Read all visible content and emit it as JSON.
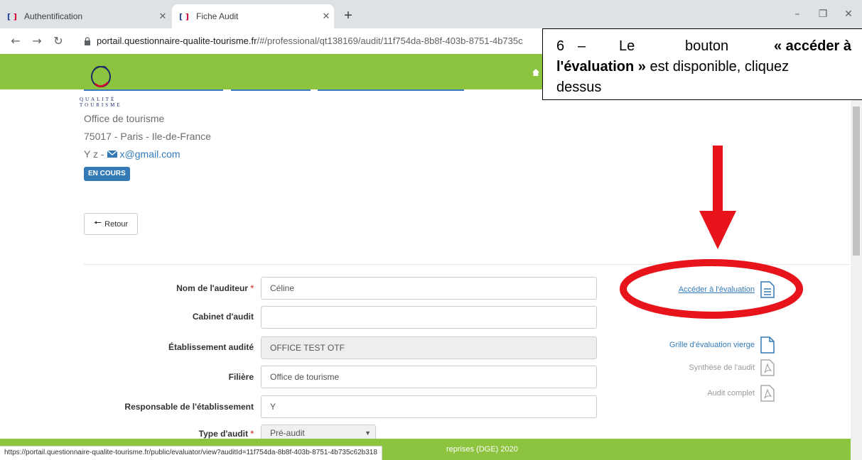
{
  "browser": {
    "tabs": [
      {
        "title": "Authentification",
        "active": false
      },
      {
        "title": "Fiche Audit",
        "active": true
      }
    ],
    "url_host": "portail.questionnaire-qualite-tourisme.fr",
    "url_path": "/#/professional/qt138169/audit/11f754da-8b8f-403b-8751-4b735c",
    "status_url": "https://portail.questionnaire-qualite-tourisme.fr/public/evaluator/view?auditId=11f754da-8b8f-403b-8751-4b735c62b318"
  },
  "colors": {
    "brand_green": "#8cc33f",
    "badge_blue": "#337ab7",
    "link_blue": "#337ab7",
    "annotation_red": "#e8141b"
  },
  "logo": {
    "text_line1": "QUALITÉ",
    "text_line2": "TOURISME"
  },
  "establishment": {
    "type": "Office de tourisme",
    "address": "75017 - Paris - Ile-de-France",
    "contact_name": "Y z -",
    "email": "x@gmail.com",
    "status_badge": "EN COURS"
  },
  "buttons": {
    "back_label": "Retour"
  },
  "form": {
    "auditor_label": "Nom de l'auditeur",
    "auditor_value": "Céline",
    "cabinet_label": "Cabinet d'audit",
    "cabinet_value": "",
    "establishment_label": "Établissement audité",
    "establishment_value": "OFFICE TEST OTF",
    "sector_label": "Filière",
    "sector_value": "Office de tourisme",
    "manager_label": "Responsable de l'établissement",
    "manager_value": "Y",
    "audit_type_label": "Type d'audit",
    "audit_type_value": "Pré-audit",
    "required_mark": "*"
  },
  "side_links": {
    "access_evaluation": "Accéder à l'évaluation",
    "blank_grid": "Grille d'évaluation vierge",
    "audit_summary": "Synthèse de l'audit",
    "full_audit": "Audit complet"
  },
  "footer": {
    "text": "reprises (DGE) 2020"
  },
  "callout": {
    "num": "6",
    "dash": "–",
    "w1": "Le",
    "w2": "bouton",
    "bold1": "« accéder à",
    "bold2": "l'évaluation »",
    "rest1": " est disponible, cliquez",
    "rest2": "dessus"
  }
}
